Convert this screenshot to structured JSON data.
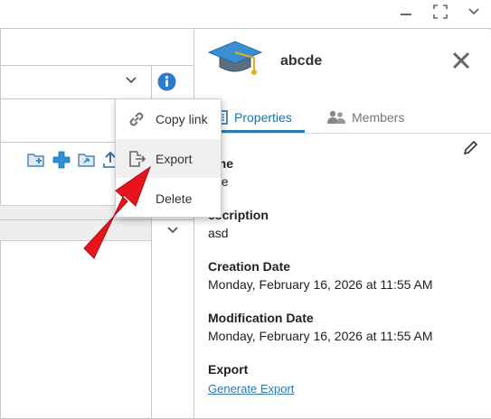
{
  "window": {
    "minimize_glyph": "—",
    "maximize_glyph": "⤢",
    "collapse_glyph": "⌄"
  },
  "panel": {
    "title": "abcde",
    "icon": "graduation-cap-icon",
    "tabs": [
      {
        "label": "Properties",
        "icon": "properties-icon",
        "active": true
      },
      {
        "label": "Members",
        "icon": "members-icon",
        "active": false
      }
    ],
    "properties": [
      {
        "label": "Name",
        "value": "abcde",
        "shown_label": "ame",
        "shown_value": "cde"
      },
      {
        "label": "Description",
        "value": "asd",
        "shown_label": "escription"
      },
      {
        "label": "Creation Date",
        "value": "Monday, February 16, 2026 at 11:55 AM"
      },
      {
        "label": "Modification Date",
        "value": "Monday, February 16, 2026 at 11:55 AM"
      },
      {
        "label": "Export",
        "link": "Generate Export"
      }
    ]
  },
  "context_menu": {
    "items": [
      {
        "label": "Copy link",
        "icon": "link-icon"
      },
      {
        "label": "Export",
        "icon": "export-icon",
        "hovered": true
      },
      {
        "label": "Delete",
        "icon": ""
      }
    ]
  },
  "colors": {
    "accent": "#2a7ab0",
    "info": "#2b7bd0",
    "annotation_arrow": "#e8141c",
    "toolbar_blue": "#2d8fd6"
  }
}
